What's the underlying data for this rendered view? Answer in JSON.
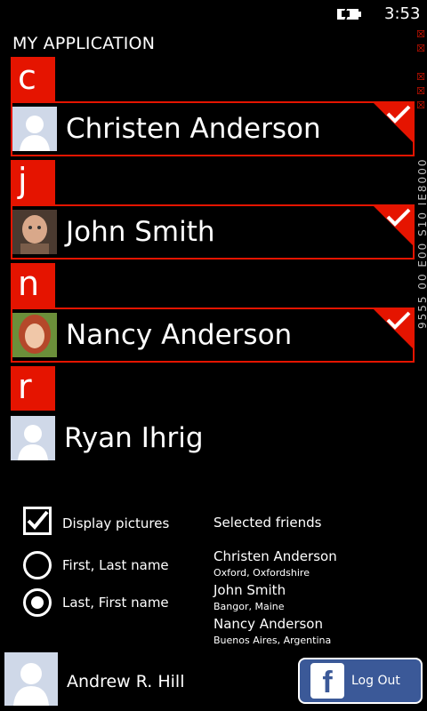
{
  "status": {
    "time": "3:53"
  },
  "app": {
    "title": "MY APPLICATION"
  },
  "groups": [
    {
      "letter": "c",
      "contact": {
        "name": "Christen Anderson",
        "selected": true,
        "picture": "generic"
      }
    },
    {
      "letter": "j",
      "contact": {
        "name": "John Smith",
        "selected": true,
        "picture": "photo"
      }
    },
    {
      "letter": "n",
      "contact": {
        "name": "Nancy Anderson",
        "selected": true,
        "picture": "photo"
      }
    },
    {
      "letter": "r",
      "contact": {
        "name": "Ryan Ihrig",
        "selected": false,
        "picture": "generic"
      }
    }
  ],
  "side_strip": {
    "text": "9555  00  E00  S10  IE8000"
  },
  "options": {
    "display_pictures": {
      "label": "Display pictures",
      "checked": true
    },
    "first_last": {
      "label": "First, Last name",
      "selected": false
    },
    "last_first": {
      "label": "Last, First name",
      "selected": true
    }
  },
  "selected_friends": {
    "title": "Selected friends",
    "items": [
      {
        "name": "Christen Anderson",
        "location": "Oxford, Oxfordshire"
      },
      {
        "name": "John Smith",
        "location": "Bangor, Maine"
      },
      {
        "name": "Nancy Anderson",
        "location": "Buenos Aires, Argentina"
      }
    ]
  },
  "user": {
    "name": "Andrew R. Hill"
  },
  "logout": {
    "label": "Log Out",
    "icon": "facebook-icon"
  },
  "colors": {
    "accent": "#e51400",
    "facebook": "#3b5998"
  }
}
